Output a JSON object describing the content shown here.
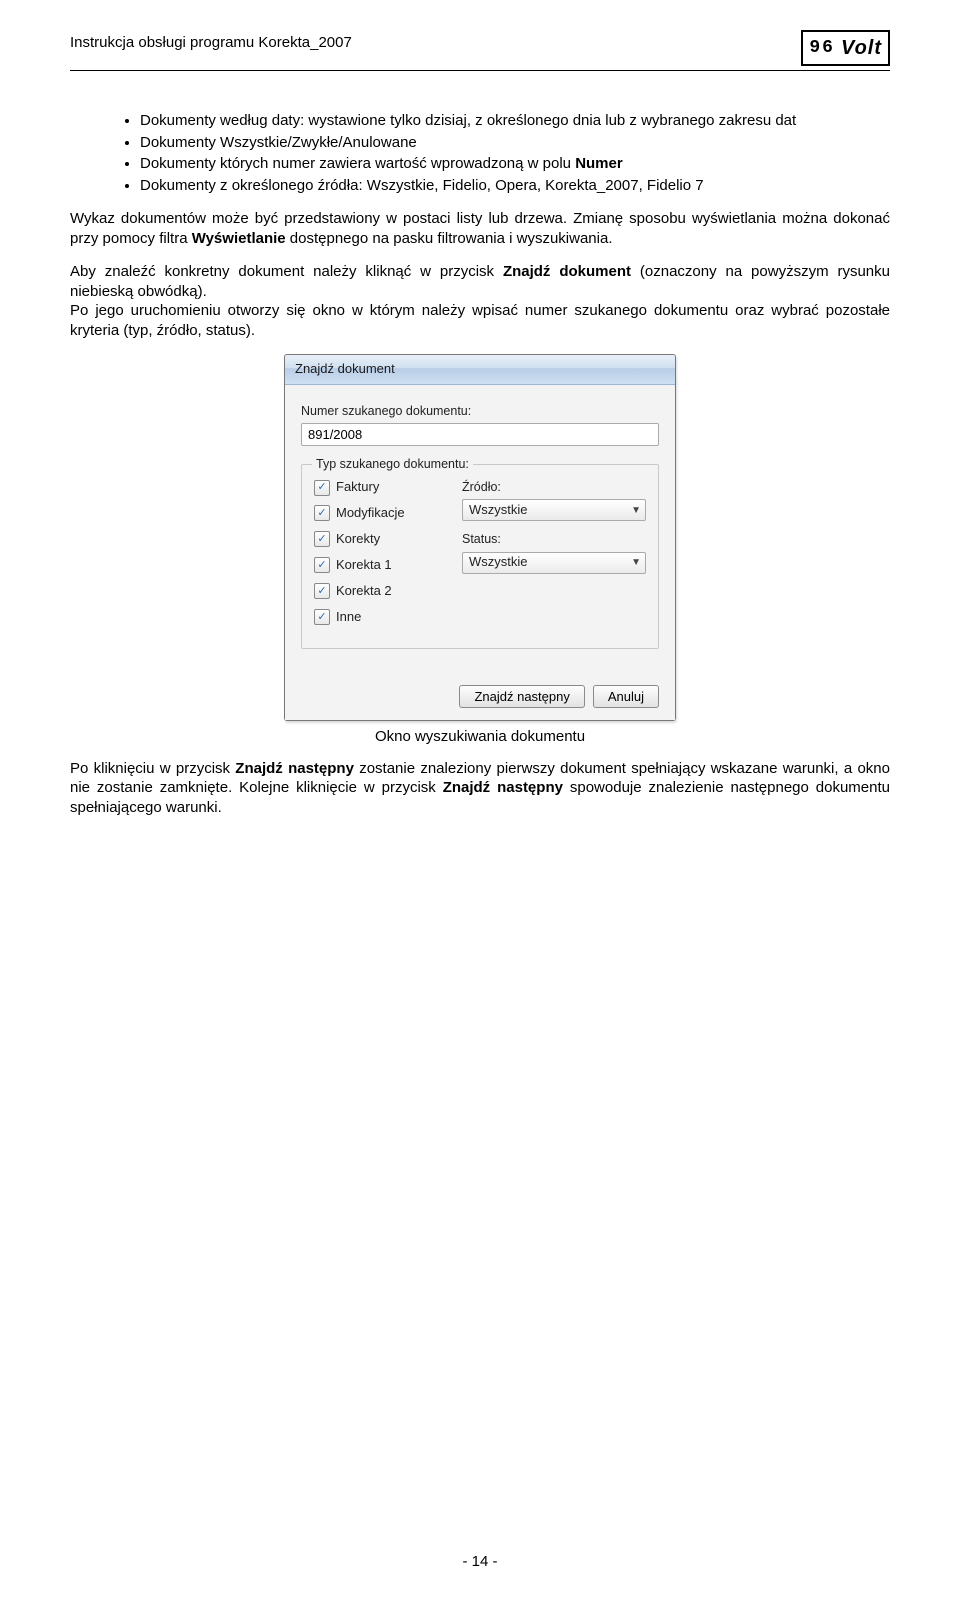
{
  "header": {
    "title": "Instrukcja obsługi programu Korekta_2007",
    "logo_left": "96",
    "logo_right": "Volt"
  },
  "bullets": [
    "Dokumenty według daty: wystawione tylko dzisiaj, z określonego dnia lub z wybranego zakresu dat",
    "Dokumenty Wszystkie/Zwykłe/Anulowane",
    "Dokumenty których numer zawiera wartość wprowadzoną w polu ",
    "Dokumenty z określonego źródła: Wszystkie, Fidelio, Opera, Korekta_2007, Fidelio 7"
  ],
  "bullet3_bold": "Numer",
  "para1_a": "Wykaz dokumentów może być przedstawiony w postaci listy lub drzewa. Zmianę sposobu wyświetlania można dokonać przy pomocy filtra ",
  "para1_bold": "Wyświetlanie",
  "para1_b": " dostępnego na pasku filtrowania i wyszukiwania.",
  "para2_a": "Aby znaleźć konkretny dokument należy kliknąć w przycisk ",
  "para2_bold": "Znajdź dokument",
  "para2_b": " (oznaczony na powyższym rysunku niebieską obwódką).",
  "para3": "Po jego uruchomieniu otworzy się okno w którym należy wpisać numer szukanego dokumentu oraz wybrać pozostałe kryteria (typ, źródło, status).",
  "dialog": {
    "title": "Znajdź dokument",
    "number_label": "Numer szukanego dokumentu:",
    "number_value": "891/2008",
    "fieldset_title": "Typ szukanego dokumentu:",
    "checks": [
      "Faktury",
      "Modyfikacje",
      "Korekty",
      "Korekta 1",
      "Korekta 2",
      "Inne"
    ],
    "source_label": "Źródło:",
    "source_value": "Wszystkie",
    "status_label": "Status:",
    "status_value": "Wszystkie",
    "btn_find": "Znajdź następny",
    "btn_cancel": "Anuluj"
  },
  "caption": "Okno wyszukiwania dokumentu",
  "para4_a": "Po kliknięciu w przycisk ",
  "para4_bold1": "Znajdź następny",
  "para4_b": " zostanie znaleziony pierwszy dokument spełniający wskazane warunki, a okno nie zostanie zamknięte. Kolejne kliknięcie w przycisk ",
  "para4_bold2": "Znajdź następny",
  "para4_c": " spowoduje znalezienie następnego dokumentu spełniającego warunki.",
  "footer": "- 14 -"
}
